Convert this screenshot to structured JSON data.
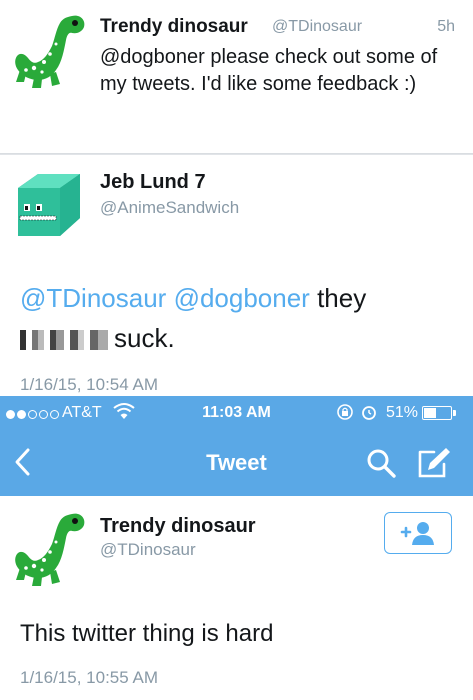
{
  "tweet1": {
    "name": "Trendy dinosaur",
    "handle": "@TDinosaur",
    "time": "5h",
    "text": "@dogboner  please check out some of my tweets. I'd like some feedback :)"
  },
  "tweet2": {
    "name": "Jeb Lund 7",
    "handle": "@AnimeSandwich",
    "mention1": "@TDinosaur",
    "mention2": "@dogboner",
    "word": "they",
    "tail": "suck.",
    "date": "1/16/15, 10:54 AM"
  },
  "status_bar": {
    "carrier": "AT&T",
    "time": "11:03 AM",
    "battery": "51%",
    "battery_level": 0.51,
    "signal_full": 2,
    "signal_total": 5
  },
  "nav": {
    "title": "Tweet",
    "back_icon": "chevron-left-icon",
    "search_icon": "search-icon",
    "compose_icon": "compose-icon"
  },
  "tweet3": {
    "name": "Trendy dinosaur",
    "handle": "@TDinosaur",
    "follow_icon": "follow-user-icon",
    "text": "This twitter thing is hard",
    "date": "1/16/15, 10:55 AM"
  },
  "colors": {
    "twitter_blue": "#55acee",
    "bar_blue": "#5aa8e6",
    "meta_gray": "#8899a6",
    "dino_green": "#2aaa3a",
    "cube_teal": "#2fbf9a"
  }
}
